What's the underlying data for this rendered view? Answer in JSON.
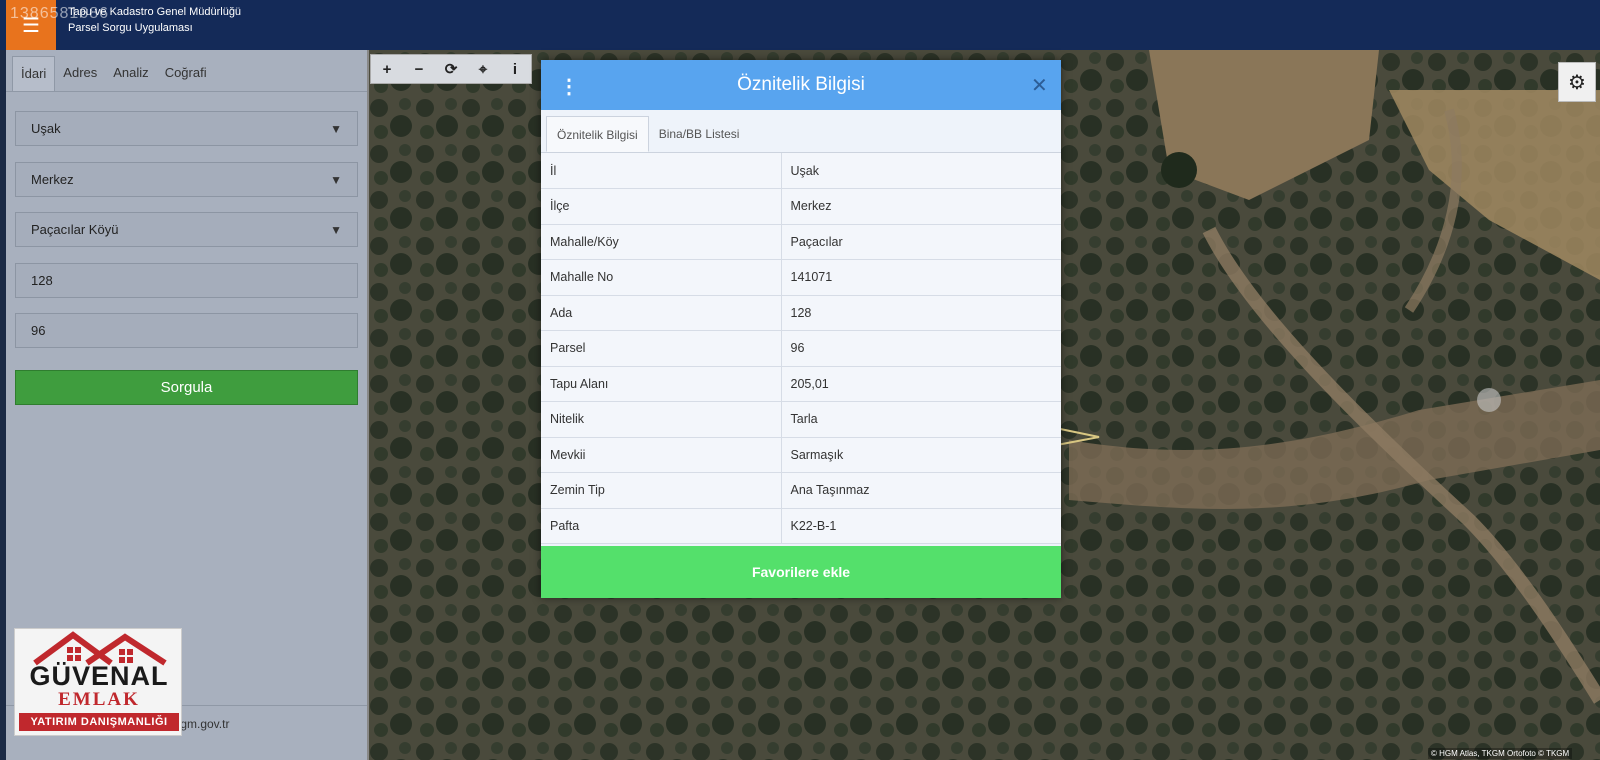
{
  "header": {
    "watermark_id": "1386581686",
    "title_line1": "Tapu ve Kadastro Genel Müdürlüğü",
    "title_line2": "Parsel Sorgu Uygulaması"
  },
  "sidebar": {
    "tabs": [
      {
        "label": "İdari",
        "active": true
      },
      {
        "label": "Adres",
        "active": false
      },
      {
        "label": "Analiz",
        "active": false
      },
      {
        "label": "Coğrafi",
        "active": false
      }
    ],
    "province": "Uşak",
    "district": "Merkez",
    "neighborhood": "Paçacılar Köyü",
    "ada": "128",
    "parsel": "96",
    "query_button": "Sorgula",
    "footer_text": "tkgm.gov.tr"
  },
  "logo": {
    "name": "GÜVENAL",
    "emlak": "EMLAK",
    "tagline": "YATIRIM DANIŞMANLIĞI"
  },
  "map": {
    "toolbar_icons": [
      "plus-icon",
      "minus-icon",
      "refresh-icon",
      "locate-icon",
      "info-icon"
    ],
    "toolbar_glyphs": [
      "+",
      "−",
      "⟳",
      "⌖",
      "i"
    ],
    "attribution": "© HGM Atlas, TKGM Ortofoto © TKGM"
  },
  "modal": {
    "title": "Öznitelik Bilgisi",
    "tabs": [
      {
        "label": "Öznitelik Bilgisi",
        "active": true
      },
      {
        "label": "Bina/BB Listesi",
        "active": false
      }
    ],
    "rows": [
      {
        "key": "İl",
        "value": "Uşak"
      },
      {
        "key": "İlçe",
        "value": "Merkez"
      },
      {
        "key": "Mahalle/Köy",
        "value": "Paçacılar"
      },
      {
        "key": "Mahalle No",
        "value": "141071"
      },
      {
        "key": "Ada",
        "value": "128"
      },
      {
        "key": "Parsel",
        "value": "96"
      },
      {
        "key": "Tapu Alanı",
        "value": "205,01"
      },
      {
        "key": "Nitelik",
        "value": "Tarla"
      },
      {
        "key": "Mevkii",
        "value": "Sarmaşık"
      },
      {
        "key": "Zemin Tip",
        "value": "Ana Taşınmaz"
      },
      {
        "key": "Pafta",
        "value": "K22-B-1"
      }
    ],
    "favorite_button": "Favorilere ekle"
  },
  "colors": {
    "header_bg": "#142a58",
    "menu_accent": "#e8731d",
    "modal_header": "#58a4ef",
    "favorite_green": "#54e06b",
    "query_green": "#3f9d3e"
  }
}
